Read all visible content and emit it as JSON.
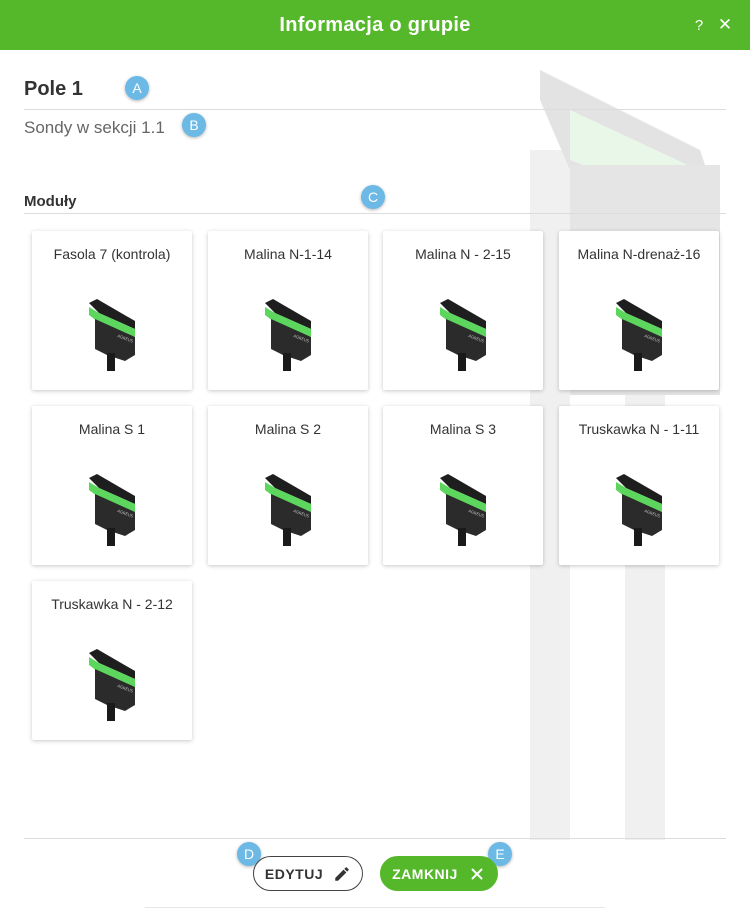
{
  "header": {
    "title": "Informacja o grupie",
    "help_label": "?",
    "close_label": "✕"
  },
  "group": {
    "name": "Pole 1",
    "description": "Sondy w sekcji 1.1"
  },
  "annotations": {
    "a": "A",
    "b": "B",
    "c": "C",
    "d": "D",
    "e": "E"
  },
  "modules": {
    "title": "Moduły",
    "items": [
      {
        "label": "Fasola 7 (kontrola)"
      },
      {
        "label": "Malina N-1-14"
      },
      {
        "label": "Malina N - 2-15"
      },
      {
        "label": "Malina N-drenaż-16"
      },
      {
        "label": "Malina S 1"
      },
      {
        "label": "Malina S 2"
      },
      {
        "label": "Malina S 3"
      },
      {
        "label": "Truskawka N - 1-11"
      },
      {
        "label": "Truskawka N - 2-12"
      }
    ],
    "sensor_brand": "AGREUS"
  },
  "footer": {
    "edit_label": "EDYTUJ",
    "close_label": "ZAMKNIJ"
  },
  "colors": {
    "accent": "#55b82b",
    "badge": "#6cb9e6"
  },
  "icons": {
    "edit": "pencil-icon",
    "close": "close-icon",
    "help": "help-icon",
    "sensor": "sensor-icon"
  }
}
